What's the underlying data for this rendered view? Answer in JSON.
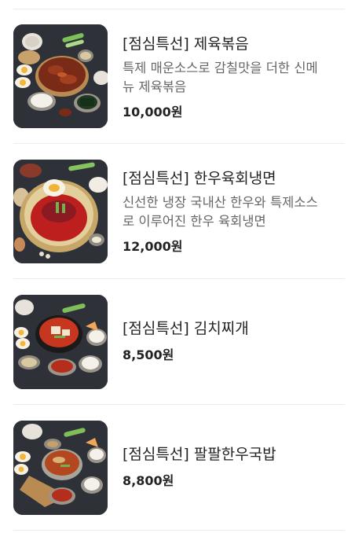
{
  "menu": {
    "items": [
      {
        "name": "[점심특선] 제육볶음",
        "description": "특제 매운소스로 감칠맛을 더한 신메뉴 제육볶음",
        "desc_lines": [
          "특제 매운소스로 감칠맛을 더한 신메",
          "뉴 제육볶음"
        ],
        "price": "10,000원"
      },
      {
        "name": "[점심특선] 한우육회냉면",
        "description": "신선한 냉장 국내산 한우와 특제소스로 이루어진 한우 육회냉면",
        "desc_lines": [
          "신선한 냉장 국내산 한우와 특제소스",
          "로 이루어진 한우 육회냉면"
        ],
        "price": "12,000원"
      },
      {
        "name": "[점심특선] 김치찌개",
        "price": "8,500원"
      },
      {
        "name": "[점심특선] 팔팔한우국밥",
        "price": "8,800원"
      }
    ]
  }
}
